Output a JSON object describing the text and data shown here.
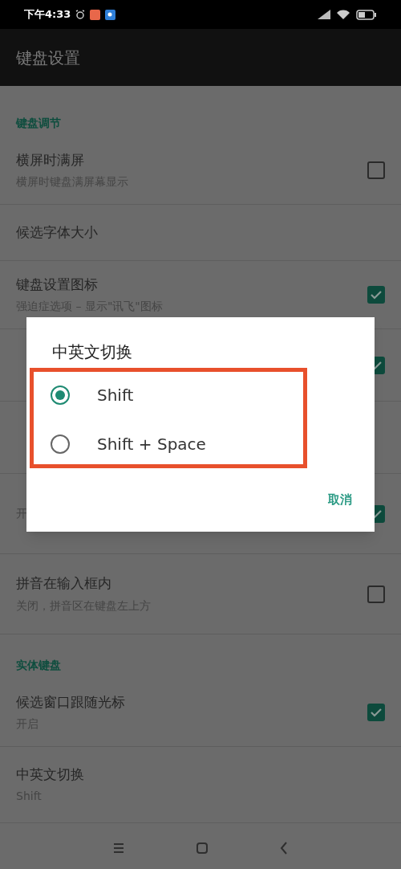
{
  "status_bar": {
    "time": "下午4:33"
  },
  "app_bar": {
    "title": "键盘设置"
  },
  "settings": [
    {
      "kind": "header",
      "title": "键盘调节"
    },
    {
      "kind": "checkbox",
      "title": "横屏时满屏",
      "subtitle": "横屏时键盘满屏幕显示",
      "checked": false
    },
    {
      "kind": "plain",
      "title": "候选字体大小"
    },
    {
      "kind": "checkbox",
      "title": "键盘设置图标",
      "subtitle": "强迫症选项 – 显示\"讯飞\"图标",
      "checked": true
    },
    {
      "kind": "checkbox",
      "checked": true
    },
    {
      "kind": "blank"
    },
    {
      "kind": "checkbox",
      "subtitle": "开",
      "checked": true
    },
    {
      "kind": "checkbox",
      "title": "拼音在输入框内",
      "subtitle": "关闭，拼音区在键盘左上方",
      "checked": false
    },
    {
      "kind": "header",
      "title": "实体键盘"
    },
    {
      "kind": "checkbox",
      "title": "候选窗口跟随光标",
      "subtitle": "开启",
      "checked": true
    },
    {
      "kind": "plain",
      "title": "中英文切换",
      "subtitle": "Shift"
    }
  ],
  "dialog": {
    "title": "中英文切换",
    "options": [
      {
        "label": "Shift",
        "selected": true
      },
      {
        "label": "Shift + Space",
        "selected": false
      }
    ],
    "button": "取消"
  }
}
